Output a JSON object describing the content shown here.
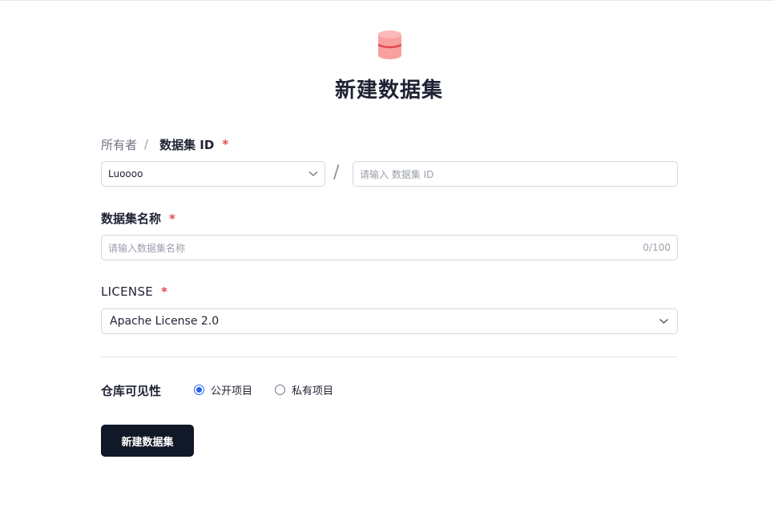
{
  "header": {
    "title": "新建数据集",
    "icon": "database-icon"
  },
  "owner_row": {
    "owner_label": "所有者",
    "separator": "/",
    "dataset_id_label": "数据集 ID",
    "required_mark": "*",
    "owner_value": "Luoooo",
    "slash": "/",
    "dataset_id_placeholder": "请输入 数据集 ID"
  },
  "name_field": {
    "label": "数据集名称",
    "required_mark": "*",
    "placeholder": "请输入数据集名称",
    "counter": "0/100"
  },
  "license_field": {
    "label": "LICENSE",
    "required_mark": "*",
    "value": "Apache License 2.0"
  },
  "visibility": {
    "label": "仓库可见性",
    "options": [
      {
        "label": "公开项目",
        "checked": true
      },
      {
        "label": "私有项目",
        "checked": false
      }
    ]
  },
  "submit": {
    "label": "新建数据集"
  },
  "colors": {
    "icon_fill": "#f9a0a0",
    "icon_band": "#e5484d",
    "required": "#e5484d",
    "radio_accent": "#2563eb",
    "button_bg": "#111827"
  }
}
